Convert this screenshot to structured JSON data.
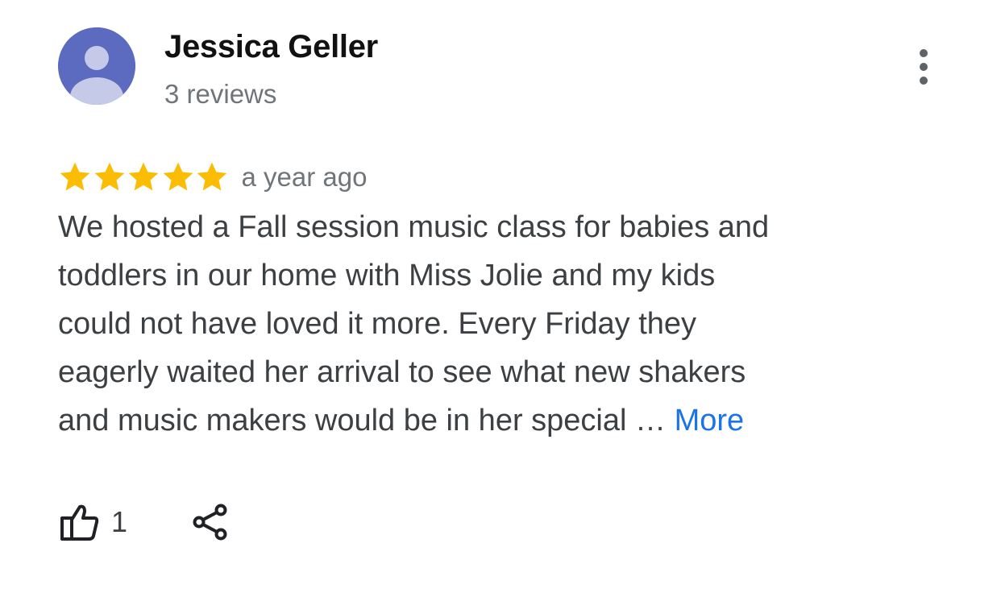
{
  "review": {
    "author": {
      "name": "Jessica Geller",
      "reviews_count": "3 reviews",
      "avatar_icon": "default-person-avatar",
      "avatar_color": "#5c6bc0"
    },
    "menu_icon": "more-vertical-icon",
    "rating": {
      "value": 5,
      "max": 5,
      "star_color": "#fbbc04"
    },
    "date": "a year ago",
    "text_lines": [
      "We hosted a Fall session music class for babies and",
      "toddlers in our home with Miss Jolie and my kids",
      "could not have loved it more. Every Friday they",
      "eagerly waited her arrival to see what new shakers",
      "and music makers would be in her special … "
    ],
    "more_label": "More",
    "more_color": "#1a73e8",
    "actions": {
      "like_icon": "thumbs-up-icon",
      "like_count": "1",
      "share_icon": "share-icon"
    }
  }
}
